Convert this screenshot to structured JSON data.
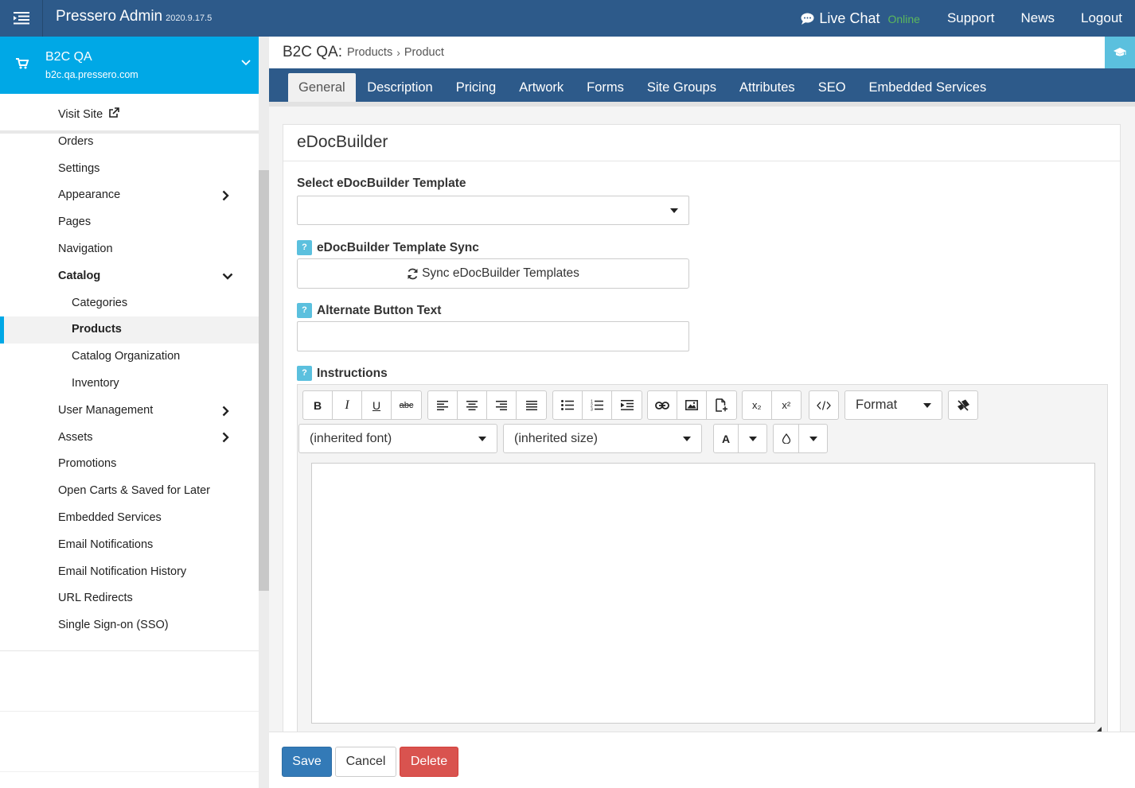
{
  "header": {
    "app_title": "Pressero Admin",
    "version": "2020.9.17.5",
    "live_chat_label": "Live Chat",
    "live_chat_status": "Online",
    "links": [
      "Support",
      "News",
      "Logout"
    ]
  },
  "site": {
    "name": "B2C QA",
    "url": "b2c.qa.pressero.com"
  },
  "sidebar": {
    "items": [
      {
        "label": "Visit Site"
      },
      {
        "label": "Orders"
      },
      {
        "label": "Settings"
      },
      {
        "label": "Appearance"
      },
      {
        "label": "Pages"
      },
      {
        "label": "Navigation"
      },
      {
        "label": "Catalog"
      },
      {
        "label": "Categories"
      },
      {
        "label": "Products"
      },
      {
        "label": "Catalog Organization"
      },
      {
        "label": "Inventory"
      },
      {
        "label": "User Management"
      },
      {
        "label": "Assets"
      },
      {
        "label": "Promotions"
      },
      {
        "label": "Open Carts & Saved for Later"
      },
      {
        "label": "Embedded Services"
      },
      {
        "label": "Email Notifications"
      },
      {
        "label": "Email Notification History"
      },
      {
        "label": "URL Redirects"
      },
      {
        "label": "Single Sign-on (SSO)"
      }
    ]
  },
  "breadcrumb": {
    "site": "B2C QA:",
    "parts": [
      "Products",
      "Product"
    ]
  },
  "tabs": [
    {
      "label": "General"
    },
    {
      "label": "Description"
    },
    {
      "label": "Pricing"
    },
    {
      "label": "Artwork"
    },
    {
      "label": "Forms"
    },
    {
      "label": "Site Groups"
    },
    {
      "label": "Attributes"
    },
    {
      "label": "SEO"
    },
    {
      "label": "Embedded Services"
    }
  ],
  "panel": {
    "title": "eDocBuilder",
    "template_label": "Select eDocBuilder Template",
    "template_value": "",
    "sync_label": "eDocBuilder Template Sync",
    "sync_button": "Sync eDocBuilder Templates",
    "alt_button_label": "Alternate Button Text",
    "alt_button_value": "",
    "instructions_label": "Instructions",
    "help_glyph": "?"
  },
  "editor": {
    "format_label": "Format",
    "font_value": "(inherited font)",
    "size_value": "(inherited size)",
    "color_glyph": "A",
    "sub_glyph": "x₂",
    "sup_glyph": "x²",
    "bold_glyph": "B",
    "italic_glyph": "I",
    "underline_glyph": "U",
    "strike_glyph": "abc"
  },
  "actions": {
    "save": "Save",
    "cancel": "Cancel",
    "delete": "Delete"
  },
  "colors": {
    "topbar": "#2d5a8a",
    "site_card": "#00a8e6",
    "help": "#5bc0de",
    "save": "#337ab7",
    "delete": "#d9534f",
    "online": "#5cb85c"
  }
}
